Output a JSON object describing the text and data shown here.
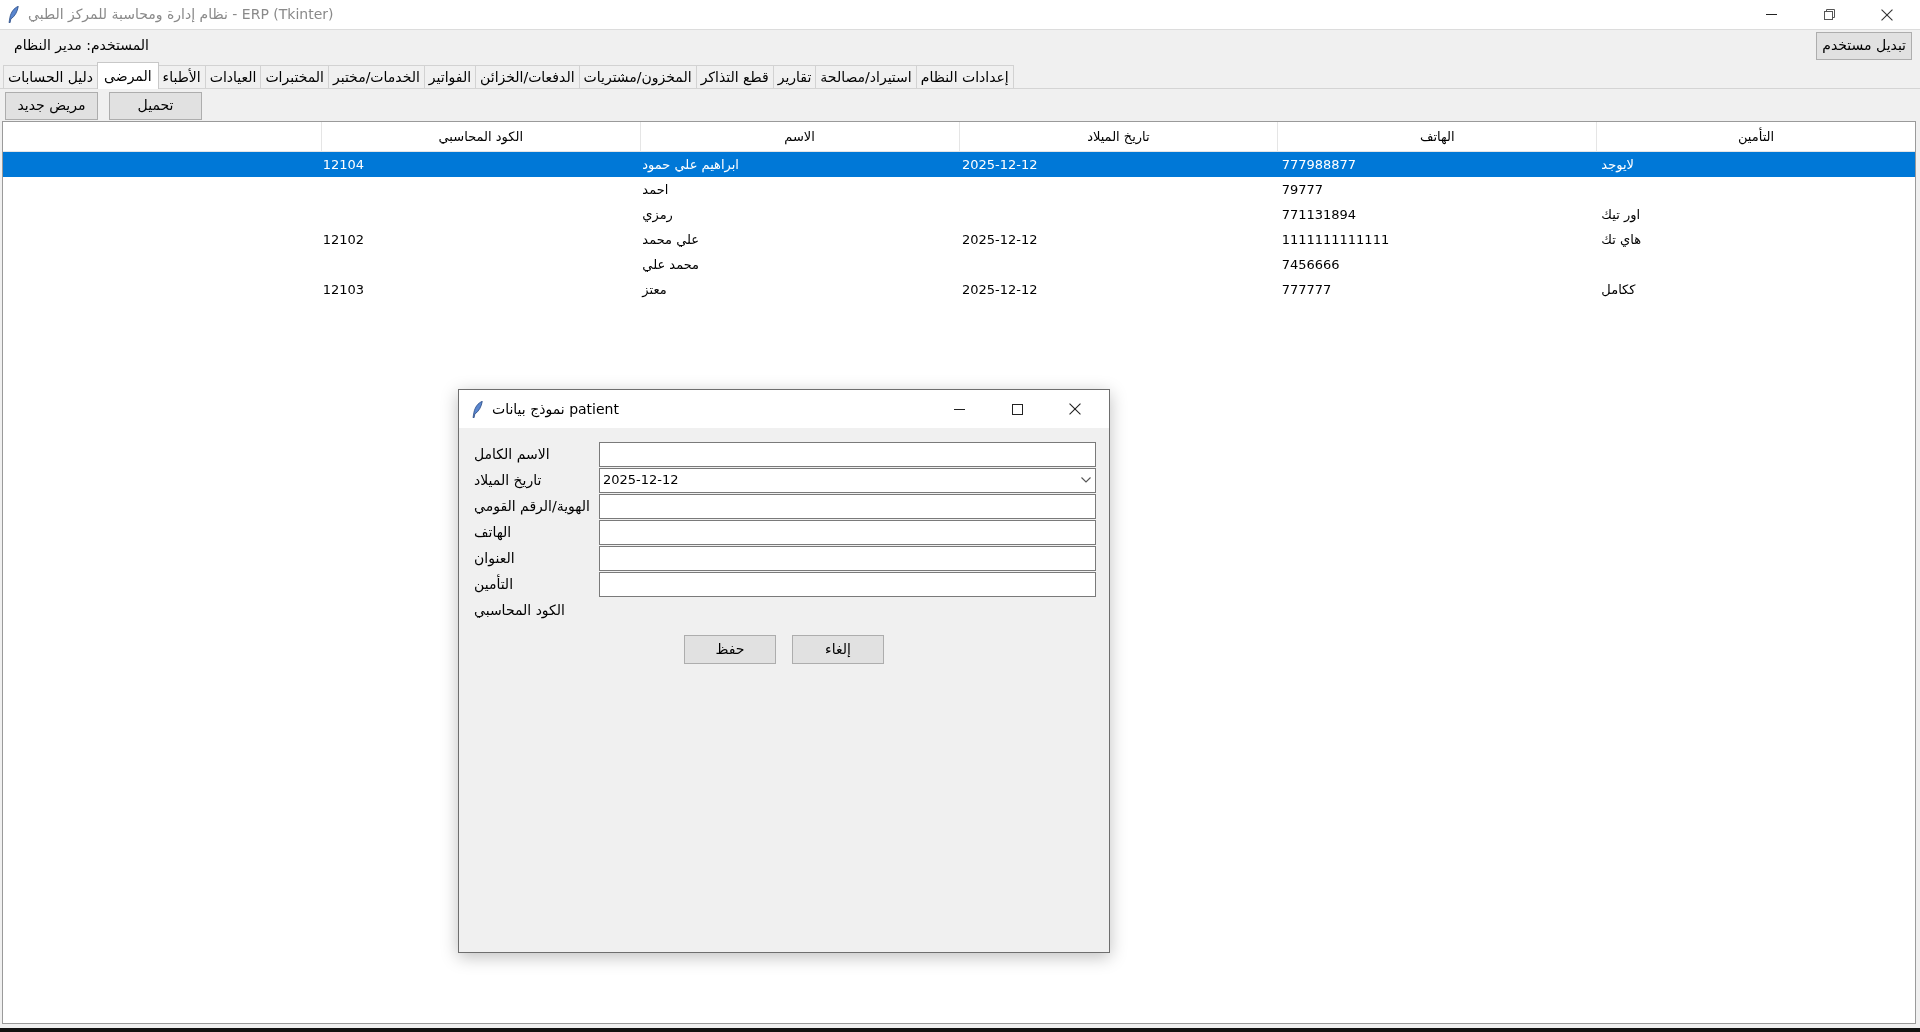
{
  "window": {
    "title": "نظام إدارة ومحاسبة للمركز الطبي - ERP (Tkinter)"
  },
  "user_label": "المستخدم: مدير النظام",
  "switch_user_button": "تبديل مستخدم",
  "tabs": [
    {
      "label": "إعدادات النظام",
      "selected": false
    },
    {
      "label": "استيراد/مصالحة",
      "selected": false
    },
    {
      "label": "تقارير",
      "selected": false
    },
    {
      "label": "قطع التذاكر",
      "selected": false
    },
    {
      "label": "المخزون/مشتريات",
      "selected": false
    },
    {
      "label": "الدفعات/الخزائن",
      "selected": false
    },
    {
      "label": "الفواتير",
      "selected": false
    },
    {
      "label": "الخدمات/مختبر",
      "selected": false
    },
    {
      "label": "المختبرات",
      "selected": false
    },
    {
      "label": "العيادات",
      "selected": false
    },
    {
      "label": "الأطباء",
      "selected": false
    },
    {
      "label": "المرضى",
      "selected": true
    },
    {
      "label": "دليل الحسابات",
      "selected": false
    }
  ],
  "toolbar": {
    "buttons": [
      "تحميل",
      "مريض جديد"
    ]
  },
  "table": {
    "columns": [
      "التأمين",
      "الهاتف",
      "تاريخ الميلاد",
      "الاسم",
      "الكود المحاسبي"
    ],
    "rows": [
      {
        "selected": true,
        "insurance": "لايوجد",
        "phone": "777988877",
        "birth_date": "2025-12-12",
        "name": "ابراهيم علي حمود",
        "account_code": "12104"
      },
      {
        "selected": false,
        "phone": "79777",
        "name": "احمد"
      },
      {
        "selected": false,
        "insurance": "اور تيك",
        "phone": "771131894",
        "name": "رمزي"
      },
      {
        "selected": false,
        "insurance": "هاي تك",
        "phone": "1111111111111",
        "birth_date": "2025-12-12",
        "name": "علي محمد",
        "account_code": "12102"
      },
      {
        "selected": false,
        "phone": "7456666",
        "name": "محمد علي"
      },
      {
        "selected": false,
        "insurance": "ككامل",
        "phone": "777777",
        "birth_date": "2025-12-12",
        "name": "معتز",
        "account_code": "12103"
      }
    ]
  },
  "dialog": {
    "title": "نموذج بيانات patient",
    "fields": [
      {
        "label": "الاسم الكامل",
        "kind": "entry"
      },
      {
        "label": "تاريخ الميلاد",
        "kind": "combobox",
        "value": "2025-12-12"
      },
      {
        "label": "الهوية/الرقم القومي",
        "kind": "entry"
      },
      {
        "label": "الهاتف",
        "kind": "entry"
      },
      {
        "label": "العنوان",
        "kind": "entry"
      },
      {
        "label": "التأمين",
        "kind": "entry"
      },
      {
        "label": "الكود المحاسبي",
        "kind": "label"
      }
    ],
    "buttons": [
      "إلغاء",
      "حفظ"
    ]
  }
}
